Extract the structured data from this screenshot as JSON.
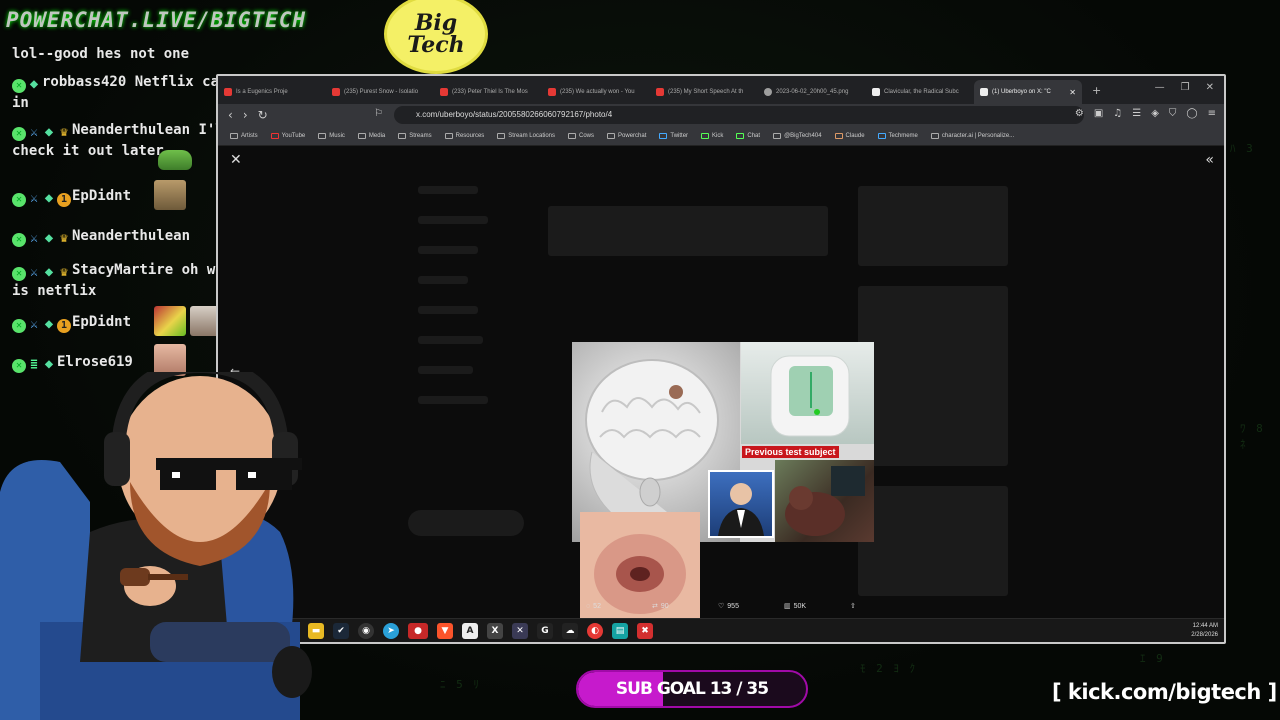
{
  "overlay": {
    "brand_text": "POWERCHAT.LIVE/BIGTECH",
    "logo_line1": "Big",
    "logo_line2": "Tech",
    "kick_url": "[ kick.com/bigtech ]",
    "sub_goal": {
      "label": "SUB GOAL 13 / 35",
      "current": 13,
      "target": 35,
      "color": "#c61acc"
    }
  },
  "chat": {
    "messages": [
      {
        "text": "lol--good hes not one"
      },
      {
        "user": "robbass420",
        "text": "Netflix cashing in"
      },
      {
        "user": "Neanderthulean",
        "text": "I'll check it out later"
      },
      {
        "user": "EpDidnt",
        "text": ""
      },
      {
        "user": "Neanderthulean",
        "text": ""
      },
      {
        "user": "StacyMartire",
        "text": "oh wow it is netflix"
      },
      {
        "user": "EpDidnt",
        "text": ""
      },
      {
        "user": "Elrose619",
        "text": ""
      }
    ]
  },
  "browser": {
    "tabs": [
      {
        "label": "Is a Eugenics Proje",
        "icon_color": "#e53935"
      },
      {
        "label": "(235) Purest Snow - Isolatio",
        "icon_color": "#e53935"
      },
      {
        "label": "(233) Peter Thiel Is The Mos",
        "icon_color": "#e53935"
      },
      {
        "label": "(235) We actually won - You",
        "icon_color": "#e53935"
      },
      {
        "label": "(235) My Short Speech At th",
        "icon_color": "#e53935"
      },
      {
        "label": "2023-06-02_20h00_45.png",
        "icon_color": "#9e9e9e"
      },
      {
        "label": "Clavicular, the Radical Subc",
        "icon_color": "#eeeeee"
      },
      {
        "label": "(1) Uberboyo on X: \"C",
        "icon_color": "#eeeeee"
      }
    ],
    "url": "x.com/uberboyo/status/2005580266060792167/photo/4",
    "bookmarks": [
      "Artists",
      "YouTube",
      "Music",
      "Media",
      "Streams",
      "Resources",
      "Stream Locations",
      "Cows",
      "Powerchat",
      "Twitter",
      "Kick",
      "Chat",
      "@BigTech404",
      "Claude",
      "Techmeme",
      "character.ai | Personalize..."
    ],
    "photo_caption": "Previous test subject",
    "actions": {
      "replies": "52",
      "reposts": "90",
      "likes": "955",
      "views": "50K"
    },
    "clock": {
      "time": "12:44 AM",
      "date": "2/28/2026"
    }
  }
}
